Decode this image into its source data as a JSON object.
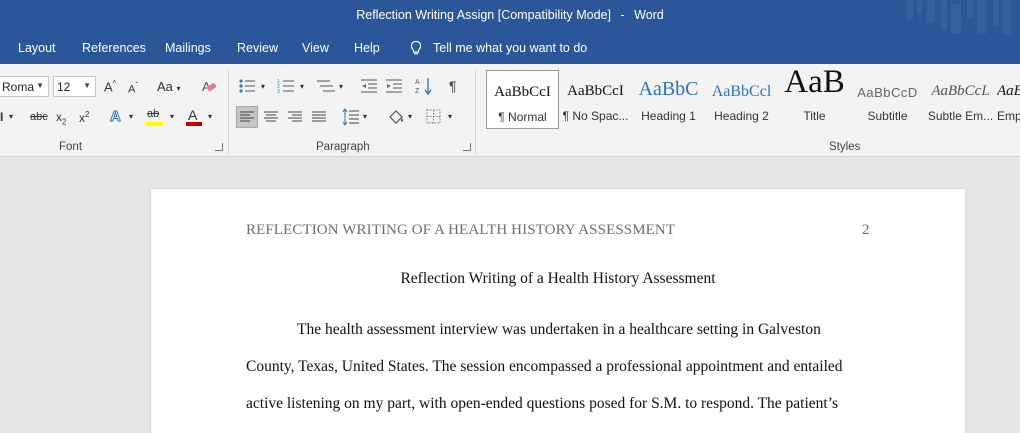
{
  "titlebar": {
    "doc_name": "Reflection Writing Assign [Compatibility Mode]",
    "separator": "-",
    "app_name": "Word",
    "bg_color": "#2b579a"
  },
  "tabs": [
    {
      "label": "Layout"
    },
    {
      "label": "References"
    },
    {
      "label": "Mailings"
    },
    {
      "label": "Review"
    },
    {
      "label": "View"
    },
    {
      "label": "Help"
    }
  ],
  "tell_me": {
    "icon": "lightbulb-icon",
    "label": "Tell me what you want to do"
  },
  "ribbon": {
    "font": {
      "font_name": "Roma",
      "font_size": "12",
      "grow_label": "A",
      "shrink_label": "A",
      "change_case_label": "Aa",
      "strike_label": "abc",
      "subscript_label": "x",
      "subscript_mark": "2",
      "superscript_label": "x",
      "superscript_mark": "2",
      "text_effects_label": "A",
      "highlight_label": "ab",
      "font_color_label": "A",
      "group_label": "Font"
    },
    "paragraph": {
      "group_label": "Paragraph",
      "pilcrow": "¶"
    },
    "styles": {
      "group_label": "Styles",
      "items": [
        {
          "sample": "AaBbCcI",
          "name": "¶ Normal",
          "selected": true
        },
        {
          "sample": "AaBbCcI",
          "name": "¶ No Spac..."
        },
        {
          "sample": "AaBbC",
          "name": "Heading 1"
        },
        {
          "sample": "AaBbCcl",
          "name": "Heading 2"
        },
        {
          "sample": "AaB",
          "name": "Title"
        },
        {
          "sample": "AaBbCcD",
          "name": "Subtitle"
        },
        {
          "sample": "AaBbCcL",
          "name": "Subtle Em..."
        },
        {
          "sample": "AaBb",
          "name": "Emp"
        }
      ]
    }
  },
  "document": {
    "running_head": "REFLECTION WRITING OF A HEALTH HISTORY ASSESSMENT",
    "page_number": "2",
    "title": "Reflection Writing of a Health History Assessment",
    "lines": [
      "The health assessment interview was undertaken in a healthcare setting in Galveston",
      "County, Texas, United States. The session encompassed a professional appointment and entailed",
      "active listening on my part, with open-ended questions posed for S.M. to respond. The patient’s"
    ]
  },
  "colors": {
    "accent": "#2b579a",
    "ribbon": "#f3f3f3",
    "workspace": "#e6e6e6",
    "font_color_bar": "#c00000",
    "highlight_bar": "#ffff00",
    "heading_blue": "#2e74b5"
  }
}
